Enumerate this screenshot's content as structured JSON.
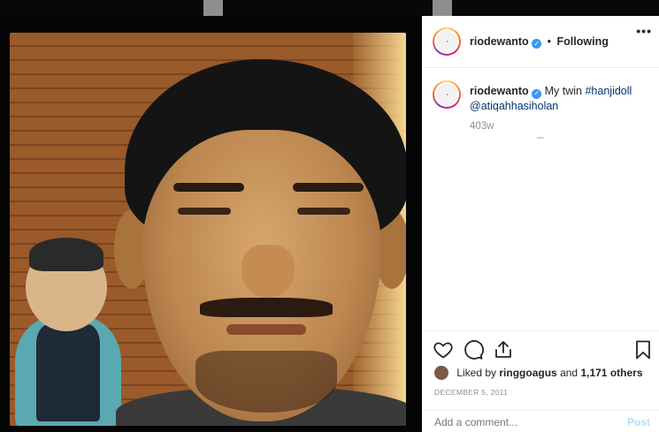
{
  "post": {
    "username": "riodewanto",
    "separator": "•",
    "follow_status": "Following",
    "more_icon": "more-horizontal-icon",
    "caption": {
      "username": "riodewanto",
      "text": "My twin ",
      "hashtag": "#hanjidoll",
      "mention": "@atiqahhasiholan"
    },
    "time_ago": "403w",
    "likes": {
      "liked_by_prefix": "Liked by",
      "user": "ringgoagus",
      "and": "and",
      "others": "1,171 others"
    },
    "date": "DECEMBER 5, 2011",
    "comment_placeholder": "Add a comment...",
    "post_label": "Post"
  },
  "colors": {
    "link": "#003569",
    "verified": "#3897f0",
    "muted": "#8e8e8e",
    "post_disabled": "#b2dffc"
  },
  "icons": [
    "heart-icon",
    "comment-icon",
    "share-icon",
    "bookmark-icon",
    "verified-icon"
  ]
}
